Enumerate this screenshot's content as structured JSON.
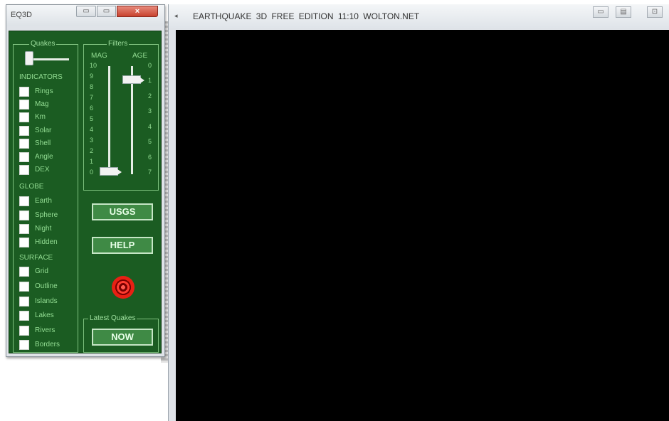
{
  "control_window": {
    "title": "EQ3D",
    "close_label": "×",
    "min_label": "▭",
    "max_label": "▭"
  },
  "quakes_panel": {
    "legend": "Quakes",
    "indicators_heading": "INDICATORS",
    "indicators": [
      "Rings",
      "Mag",
      "Km",
      "Solar",
      "Shell",
      "Angle",
      "DEX"
    ],
    "globe_heading": "GLOBE",
    "globe": [
      "Earth",
      "Sphere",
      "Night",
      "Hidden"
    ],
    "surface_heading": "SURFACE",
    "surface": [
      "Grid",
      "Outline",
      "Islands",
      "Lakes",
      "Rivers",
      "Borders"
    ]
  },
  "filters_panel": {
    "legend": "Filters",
    "mag_label": "MAG",
    "age_label": "AGE",
    "mag_ticks": [
      "10",
      "9",
      "8",
      "7",
      "6",
      "5",
      "4",
      "3",
      "2",
      "1",
      "0"
    ],
    "age_ticks": [
      "0",
      "1",
      "2",
      "3",
      "4",
      "5",
      "6",
      "7"
    ],
    "mag_value": 0,
    "age_value": 1
  },
  "buttons": {
    "usgs": "USGS",
    "help": "HELP",
    "now": "NOW"
  },
  "latest_panel": {
    "legend": "Latest Quakes"
  },
  "main_window": {
    "title": "EARTHQUAKE 3D   FREE EDITION   11:10   WOLTON.NET",
    "sys_icon": "◂",
    "min_label": "▭",
    "max_label": "▤",
    "close_label": "⊡"
  },
  "colors": {
    "panel_green": "#1b5c22",
    "label_green": "#92dc92",
    "button_green": "#3f8a45",
    "target_red": "#e82014",
    "canvas": "#000000"
  }
}
